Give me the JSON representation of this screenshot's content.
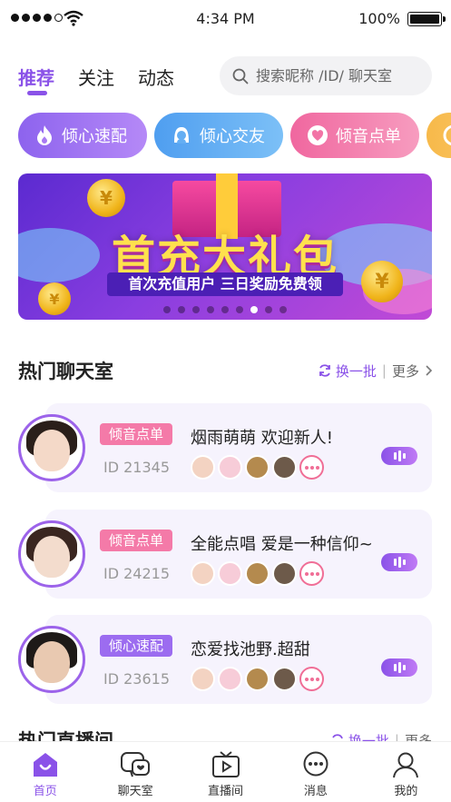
{
  "status_bar": {
    "time": "4:34 PM",
    "battery": "100%"
  },
  "tabs": [
    {
      "label": "推荐",
      "active": true
    },
    {
      "label": "关注",
      "active": false
    },
    {
      "label": "动态",
      "active": false
    }
  ],
  "search": {
    "placeholder": "搜索昵称 /ID/ 聊天室"
  },
  "categories": [
    {
      "label": "倾心速配",
      "color": "#9c6cf0",
      "icon": "flame-icon"
    },
    {
      "label": "倾心交友",
      "color": "#58a8f2",
      "icon": "friends-icon"
    },
    {
      "label": "倾音点单",
      "color": "#f572a4",
      "icon": "heart-icon"
    }
  ],
  "banner": {
    "title": "首充大礼包",
    "subtitle": "首次充值用户 三日奖励免费领",
    "coin_symbol": "¥",
    "dot_count": 9,
    "active_dot": 6
  },
  "hot_rooms": {
    "title": "热门聊天室",
    "swap_label": "换一批",
    "more_label": "更多",
    "items": [
      {
        "tag": "倾音点单",
        "tag_color": "#f47aa8",
        "id": "ID 21345",
        "title": "烟雨萌萌 欢迎新人!"
      },
      {
        "tag": "倾音点单",
        "tag_color": "#f47aa8",
        "id": "ID 24215",
        "title": "全能点唱 爱是一种信仰~"
      },
      {
        "tag": "倾心速配",
        "tag_color": "#9c6cf0",
        "id": "ID 23615",
        "title": "恋爱找池野.超甜"
      }
    ]
  },
  "hot_live": {
    "title": "热门直播间",
    "swap_label": "换一批",
    "more_label": "更多"
  },
  "bottom_nav": [
    {
      "label": "首页",
      "icon": "home-icon",
      "active": true
    },
    {
      "label": "聊天室",
      "icon": "chat-room-icon",
      "active": false
    },
    {
      "label": "直播间",
      "icon": "tv-icon",
      "active": false
    },
    {
      "label": "消息",
      "icon": "message-icon",
      "active": false
    },
    {
      "label": "我的",
      "icon": "profile-icon",
      "active": false
    }
  ]
}
